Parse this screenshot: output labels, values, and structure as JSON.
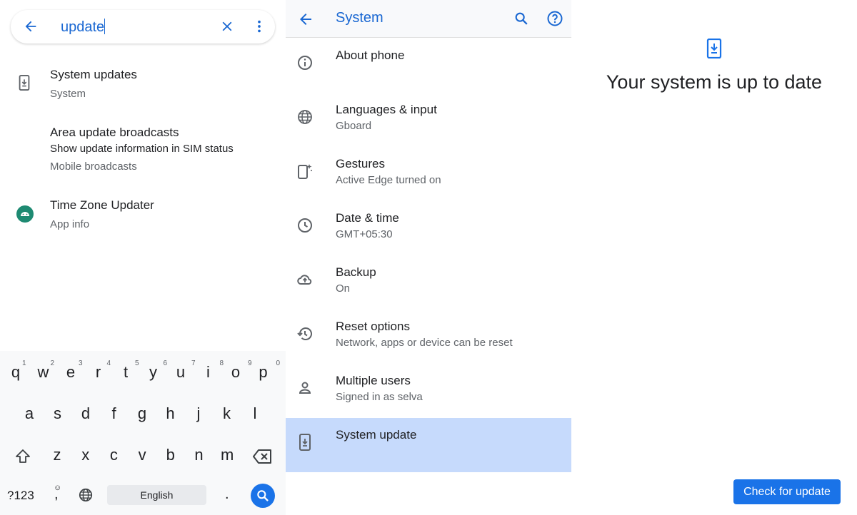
{
  "search_panel": {
    "query": "update",
    "results": [
      {
        "title": "System updates",
        "subtitle": "System",
        "icon": "system-update-icon"
      },
      {
        "title": "Area update broadcasts",
        "summary": "Show update information in SIM status",
        "subtitle": "Mobile broadcasts"
      },
      {
        "title": "Time Zone Updater",
        "subtitle": "App info",
        "icon": "android-icon"
      }
    ]
  },
  "keyboard": {
    "row1": [
      "q",
      "w",
      "e",
      "r",
      "t",
      "y",
      "u",
      "i",
      "o",
      "p"
    ],
    "row1_numbers": [
      "1",
      "2",
      "3",
      "4",
      "5",
      "6",
      "7",
      "8",
      "9",
      "0"
    ],
    "row2": [
      "a",
      "s",
      "d",
      "f",
      "g",
      "h",
      "j",
      "k",
      "l"
    ],
    "row3": [
      "z",
      "x",
      "c",
      "v",
      "b",
      "n",
      "m"
    ],
    "symbols_key": "?123",
    "comma_key": ",",
    "space_label": "English",
    "period_key": ".",
    "accent": "#1a73e8"
  },
  "system_panel": {
    "title": "System",
    "items": [
      {
        "title": "About phone",
        "subtitle": "",
        "icon": "info-icon"
      },
      {
        "title": "Languages & input",
        "subtitle": "Gboard",
        "icon": "globe-icon"
      },
      {
        "title": "Gestures",
        "subtitle": "Active Edge turned on",
        "icon": "gestures-icon"
      },
      {
        "title": "Date & time",
        "subtitle": "GMT+05:30",
        "icon": "clock-icon"
      },
      {
        "title": "Backup",
        "subtitle": "On",
        "icon": "cloud-backup-icon"
      },
      {
        "title": "Reset options",
        "subtitle": "Network, apps or device can be reset",
        "icon": "history-icon"
      },
      {
        "title": "Multiple users",
        "subtitle": "Signed in as selva",
        "icon": "person-icon"
      },
      {
        "title": "System update",
        "subtitle": "",
        "icon": "system-update-icon",
        "selected": true
      }
    ]
  },
  "update_panel": {
    "status": "Your system is up to date",
    "button": "Check for update"
  },
  "colors": {
    "accent": "#1a73e8",
    "title_blue": "#1967d2",
    "selected_row": "#c6dafc"
  }
}
